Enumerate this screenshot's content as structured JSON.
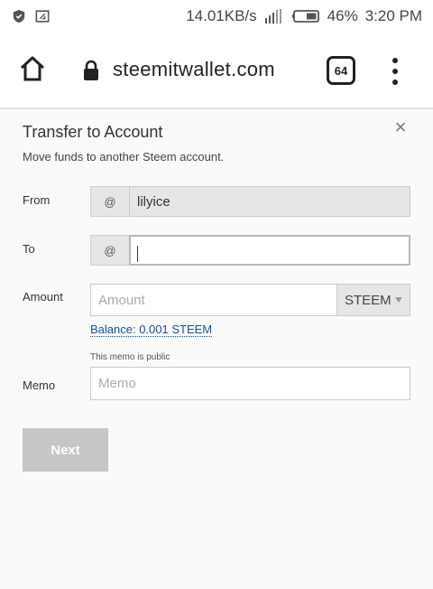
{
  "status_bar": {
    "network_speed": "14.01KB/s",
    "battery_percent": "46%",
    "time": "3:20 PM",
    "icons": [
      "shield-icon",
      "cast-icon",
      "signal-icon",
      "battery-icon"
    ]
  },
  "browser": {
    "url": "steemitwallet.com",
    "tab_count": "64",
    "icons": [
      "home-icon",
      "lock-icon",
      "tabs-icon",
      "overflow-menu-icon"
    ]
  },
  "dialog": {
    "title": "Transfer to Account",
    "subtitle": "Move funds to another Steem account.",
    "close_icon": "×",
    "from": {
      "label": "From",
      "prefix": "@",
      "value": "lilyice"
    },
    "to": {
      "label": "To",
      "prefix": "@",
      "value": ""
    },
    "amount": {
      "label": "Amount",
      "placeholder": "Amount",
      "asset": "STEEM"
    },
    "balance": "Balance: 0.001 STEEM",
    "memo": {
      "label": "Memo",
      "note": "This memo is public",
      "placeholder": "Memo"
    },
    "next_label": "Next"
  },
  "colors": {
    "link": "#1a5099",
    "button_disabled": "#c6c6c6",
    "input_prefix_bg": "#e6e6e6"
  }
}
